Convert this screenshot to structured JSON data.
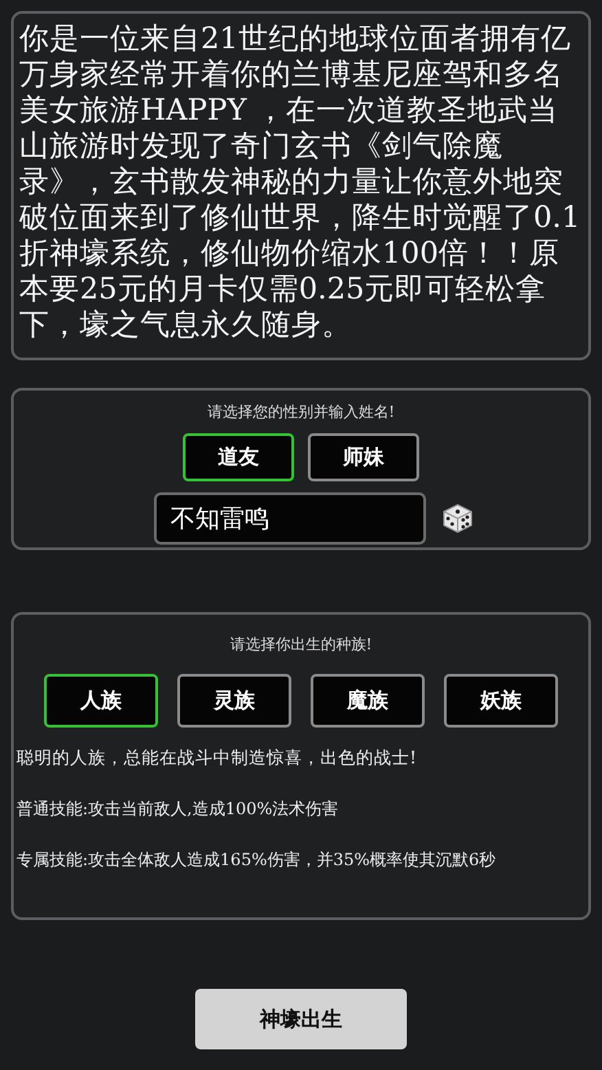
{
  "intro": "你是一位来自21世纪的地球位面者拥有亿万身家经常开着你的兰博基尼座驾和多名美女旅游HAPPY ，在一次道教圣地武当山旅游时发现了奇门玄书《剑气除魔录》，玄书散发神秘的力量让你意外地突破位面来到了修仙世界，降生时觉醒了0.1折神壕系统，修仙物价缩水100倍！！原本要25元的月卡仅需0.25元即可轻松拿下，壕之气息永久随身。",
  "gender": {
    "prompt": "请选择您的性别并输入姓名!",
    "options": [
      {
        "label": "道友",
        "selected": true
      },
      {
        "label": "师妹",
        "selected": false
      }
    ],
    "name_value": "不知雷鸣"
  },
  "race": {
    "prompt": "请选择你出生的种族!",
    "options": [
      {
        "label": "人族",
        "selected": true
      },
      {
        "label": "灵族",
        "selected": false
      },
      {
        "label": "魔族",
        "selected": false
      },
      {
        "label": "妖族",
        "selected": false
      }
    ],
    "description": "聪明的人族，总能在战斗中制造惊喜，出色的战士!",
    "skills": [
      "普通技能:攻击当前敌人,造成100%法术伤害",
      "专属技能:攻击全体敌人造成165%伤害，并35%概率使其沉默6秒"
    ]
  },
  "confirm_button": "神壕出生"
}
